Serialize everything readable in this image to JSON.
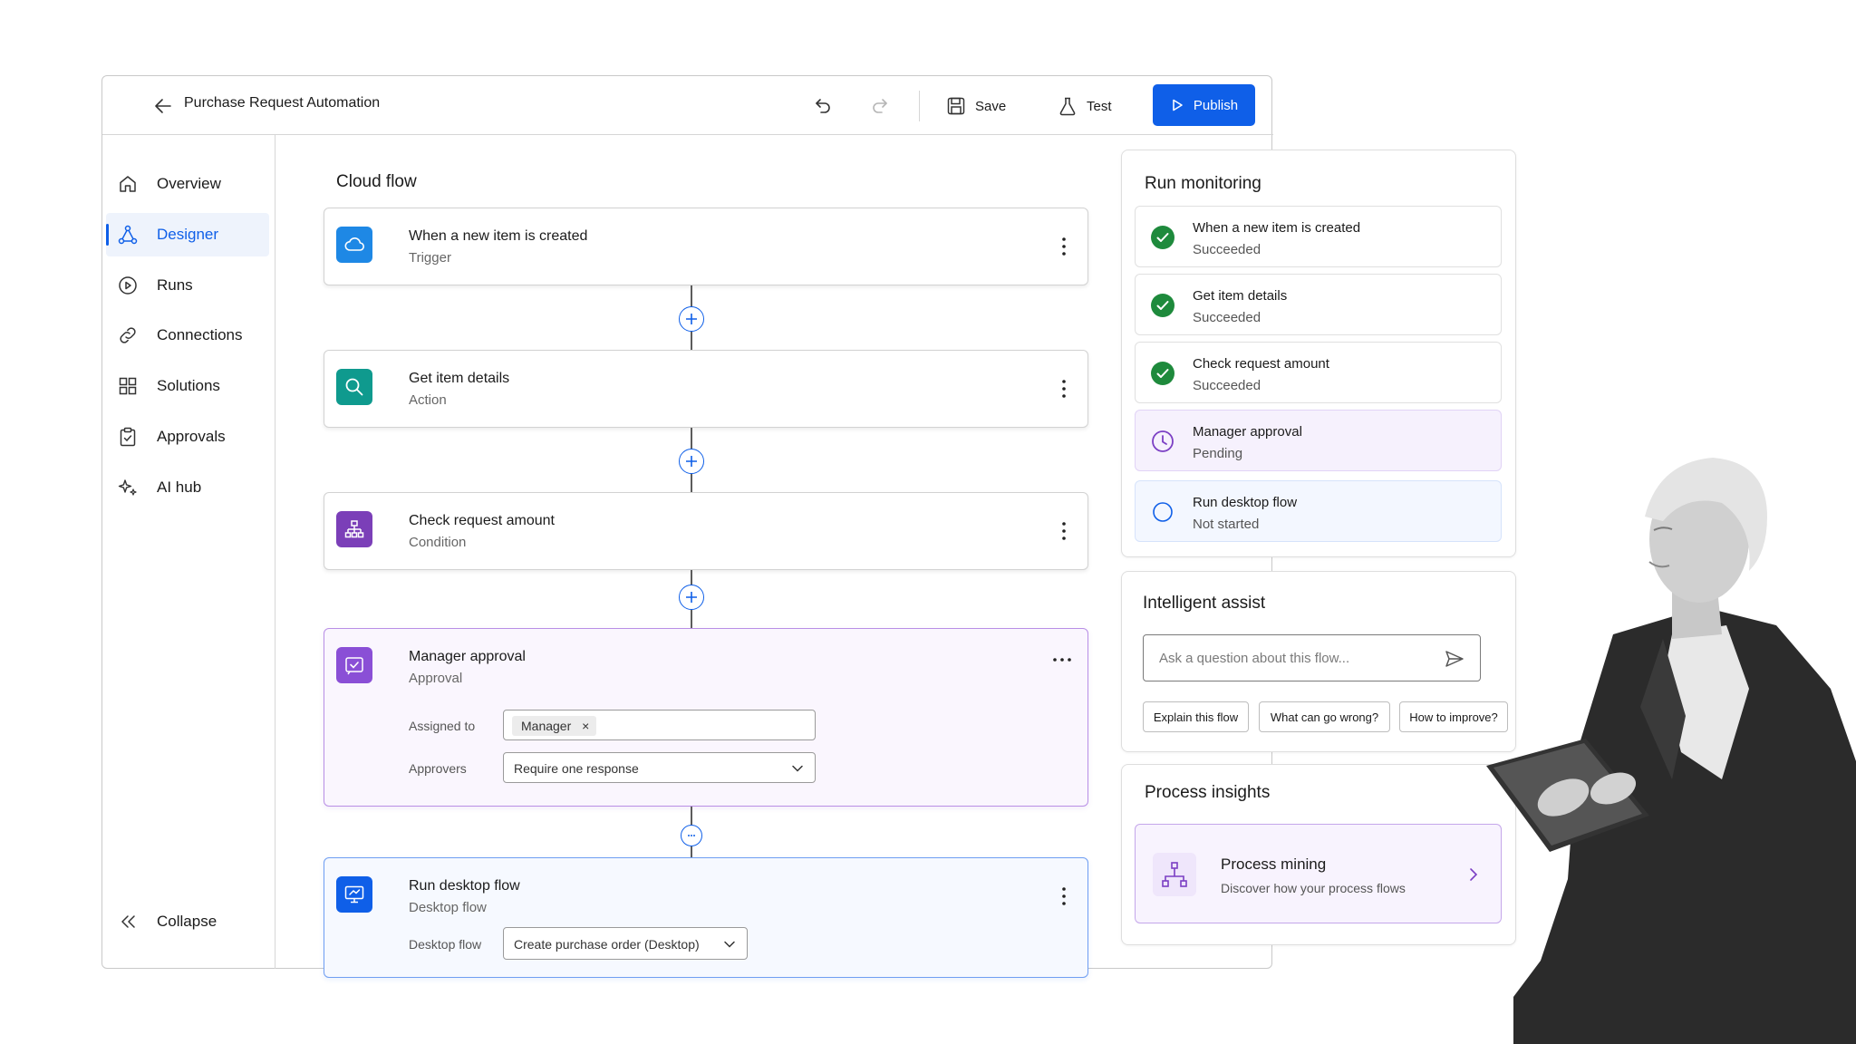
{
  "header": {
    "title": "Purchase Request Automation",
    "save_label": "Save",
    "test_label": "Test",
    "publish_label": "Publish"
  },
  "sidebar": {
    "items": [
      {
        "label": "Overview",
        "icon": "home-icon"
      },
      {
        "label": "Designer",
        "icon": "flow-icon",
        "active": true
      },
      {
        "label": "Runs",
        "icon": "play-circle-icon"
      },
      {
        "label": "Connections",
        "icon": "link-icon"
      },
      {
        "label": "Solutions",
        "icon": "grid-icon"
      },
      {
        "label": "Approvals",
        "icon": "clipboard-check-icon"
      },
      {
        "label": "AI  hub",
        "icon": "sparkle-icon"
      }
    ],
    "collapse_label": "Collapse"
  },
  "flow": {
    "title": "Cloud flow",
    "steps": [
      {
        "title": "When a new item is created",
        "subtitle": "Trigger",
        "icon": "cloud-icon",
        "color": "#1e88e5"
      },
      {
        "title": "Get item details",
        "subtitle": "Action",
        "icon": "search-icon",
        "color": "#0f9a8e"
      },
      {
        "title": "Check request amount",
        "subtitle": "Condition",
        "icon": "condition-icon",
        "color": "#7b3fb8"
      },
      {
        "title": "Manager approval",
        "subtitle": "Approval",
        "icon": "approval-icon",
        "color": "#8a4fd6"
      },
      {
        "title": "Run desktop flow",
        "subtitle": "Desktop flow",
        "icon": "desktop-flow-icon",
        "color": "#0f5fe8"
      }
    ],
    "approval": {
      "assigned_label": "Assigned to",
      "assigned_chip": "Manager",
      "chip_remove": "×",
      "approvers_label": "Approvers",
      "approvers_value": "Require one response"
    },
    "desktop": {
      "field_label": "Desktop flow",
      "field_value": "Create purchase order (Desktop)"
    }
  },
  "monitoring": {
    "title": "Run monitoring",
    "runs": [
      {
        "name": "When a new item is created",
        "status": "Succeeded"
      },
      {
        "name": "Get item details",
        "status": "Succeeded"
      },
      {
        "name": "Check request amount",
        "status": "Succeeded"
      },
      {
        "name": "Manager approval",
        "status": "Pending"
      },
      {
        "name": "Run desktop flow",
        "status": "Not started"
      }
    ]
  },
  "assist": {
    "title": "Intelligent assist",
    "placeholder": "Ask a question about this flow...",
    "suggestions": [
      "Explain this flow",
      "What can go wrong?",
      "How to improve?"
    ]
  },
  "insights": {
    "title": "Process insights",
    "card_title": "Process mining",
    "card_subtitle": "Discover how your process flows"
  },
  "colors": {
    "accent": "#0f5fe8",
    "success": "#1e8a3c",
    "pending": "#7b3fc4",
    "selected_border": "#b98fe6"
  }
}
